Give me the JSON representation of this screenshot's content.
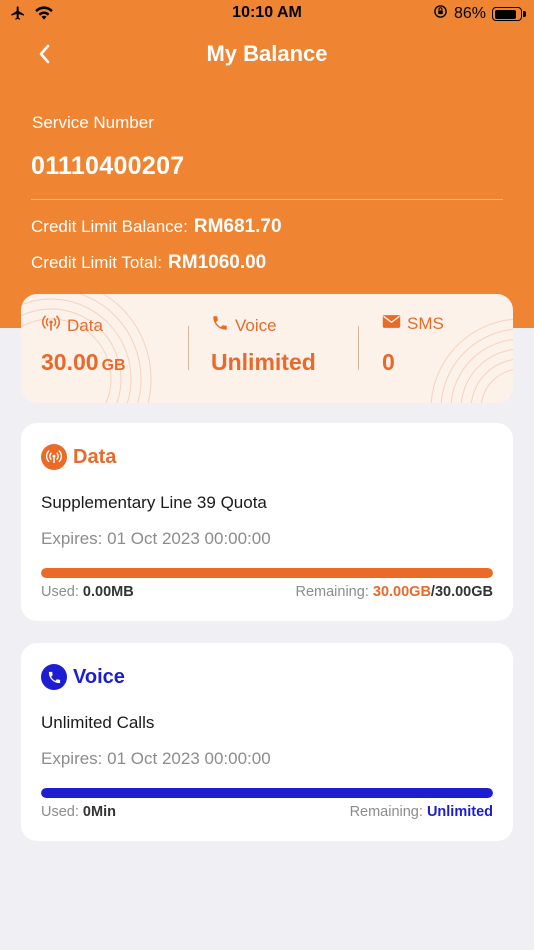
{
  "status_bar": {
    "time": "10:10 AM",
    "battery_percent": "86%",
    "battery_level": 0.86
  },
  "nav": {
    "title": "My Balance",
    "back_icon": "chevron-left-icon"
  },
  "account": {
    "service_number_label": "Service Number",
    "service_number": "01110400207",
    "credit_balance_label": "Credit Limit Balance:",
    "credit_balance": "RM681.70",
    "credit_total_label": "Credit Limit Total:",
    "credit_total": "RM1060.00"
  },
  "summary": {
    "data": {
      "label": "Data",
      "value": "30.00",
      "unit": "GB",
      "icon": "antenna-icon"
    },
    "voice": {
      "label": "Voice",
      "value": "Unlimited",
      "icon": "phone-icon"
    },
    "sms": {
      "label": "SMS",
      "value": "0",
      "icon": "envelope-icon"
    }
  },
  "data_card": {
    "title": "Data",
    "plan": "Supplementary Line 39 Quota",
    "expires_label": "Expires:",
    "expires_value": "01 Oct 2023 00:00:00",
    "used_label": "Used:",
    "used_value": "0.00MB",
    "remaining_label": "Remaining:",
    "remaining_value": "30.00GB",
    "remaining_total": "/30.00GB",
    "remaining_fraction": 1.0
  },
  "voice_card": {
    "title": "Voice",
    "plan": "Unlimited Calls",
    "expires_label": "Expires:",
    "expires_value": "01 Oct 2023 00:00:00",
    "used_label": "Used:",
    "used_value": "0Min",
    "remaining_label": "Remaining:",
    "remaining_value": "Unlimited",
    "remaining_fraction": 1.0
  },
  "colors": {
    "brand_orange": "#ef8432",
    "accent_orange": "#ea6a28",
    "voice_blue": "#1d1dd2"
  }
}
